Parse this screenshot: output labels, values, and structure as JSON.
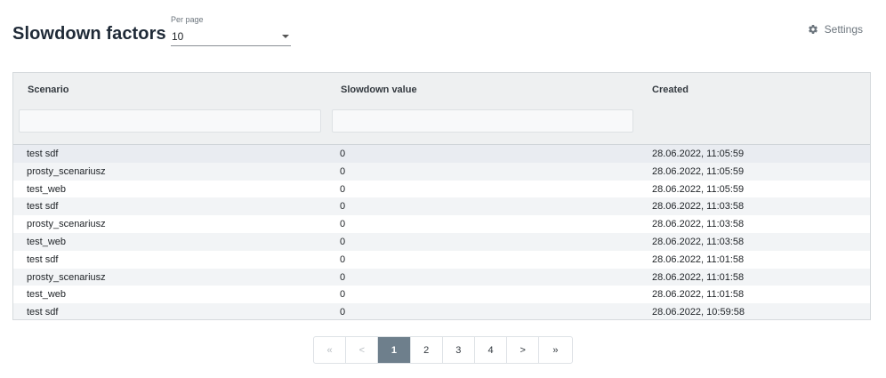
{
  "header": {
    "title": "Slowdown factors",
    "per_page_label": "Per page",
    "per_page_value": "10",
    "settings_label": "Settings"
  },
  "table": {
    "columns": [
      "Scenario",
      "Slowdown value",
      "Created"
    ],
    "rows": [
      {
        "scenario": "test sdf",
        "value": "0",
        "created": "28.06.2022, 11:05:59"
      },
      {
        "scenario": "prosty_scenariusz",
        "value": "0",
        "created": "28.06.2022, 11:05:59"
      },
      {
        "scenario": "test_web",
        "value": "0",
        "created": "28.06.2022, 11:05:59"
      },
      {
        "scenario": "test sdf",
        "value": "0",
        "created": "28.06.2022, 11:03:58"
      },
      {
        "scenario": "prosty_scenariusz",
        "value": "0",
        "created": "28.06.2022, 11:03:58"
      },
      {
        "scenario": "test_web",
        "value": "0",
        "created": "28.06.2022, 11:03:58"
      },
      {
        "scenario": "test sdf",
        "value": "0",
        "created": "28.06.2022, 11:01:58"
      },
      {
        "scenario": "prosty_scenariusz",
        "value": "0",
        "created": "28.06.2022, 11:01:58"
      },
      {
        "scenario": "test_web",
        "value": "0",
        "created": "28.06.2022, 11:01:58"
      },
      {
        "scenario": "test sdf",
        "value": "0",
        "created": "28.06.2022, 10:59:58"
      }
    ]
  },
  "pagination": {
    "first": "«",
    "prev": "<",
    "pages": [
      "1",
      "2",
      "3",
      "4"
    ],
    "active_page": "1",
    "next": ">",
    "last": "»"
  },
  "icons": {
    "settings": "gear-icon",
    "per_page_dropdown": "caret-down-icon"
  },
  "colors": {
    "active_page_bg": "#6e7f8c",
    "header_bg": "#eef0f1",
    "alt_row_bg": "#f2f4f6"
  }
}
